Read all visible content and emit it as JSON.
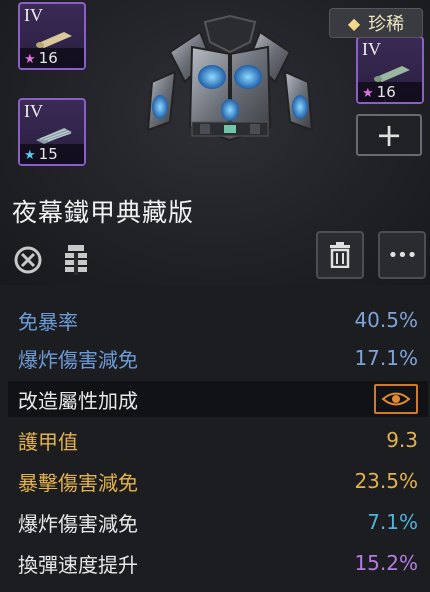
{
  "item": {
    "name": "夜幕鐵甲典藏版",
    "rarity": "珍稀"
  },
  "slots": [
    {
      "tier": "IV",
      "level": "16",
      "star_color": "#e070e0"
    },
    {
      "tier": "IV",
      "level": "15",
      "star_color": "#5ac8f0"
    },
    {
      "tier": "IV",
      "level": "16",
      "star_color": "#e070e0"
    }
  ],
  "buttons": {
    "add": "+",
    "more": "•••"
  },
  "stats": [
    {
      "label": "免暴率",
      "value": "40.5%"
    },
    {
      "label": "爆炸傷害減免",
      "value": "17.1%"
    }
  ],
  "mod_section": {
    "title": "改造屬性加成"
  },
  "mod_stats": [
    {
      "label": "護甲值",
      "value": "9.3"
    },
    {
      "label": "暴擊傷害減免",
      "value": "23.5%"
    },
    {
      "label": "爆炸傷害減免",
      "value": "7.1%"
    },
    {
      "label": "換彈速度提升",
      "value": "15.2%"
    }
  ],
  "colors": {
    "slot_border": "#8a5fc7",
    "stat_blue": "#6e9bd8",
    "gold": "#e3b24c",
    "cyan": "#4fb3d8",
    "purple": "#b57be0",
    "eye_orange": "#d07a2a"
  }
}
